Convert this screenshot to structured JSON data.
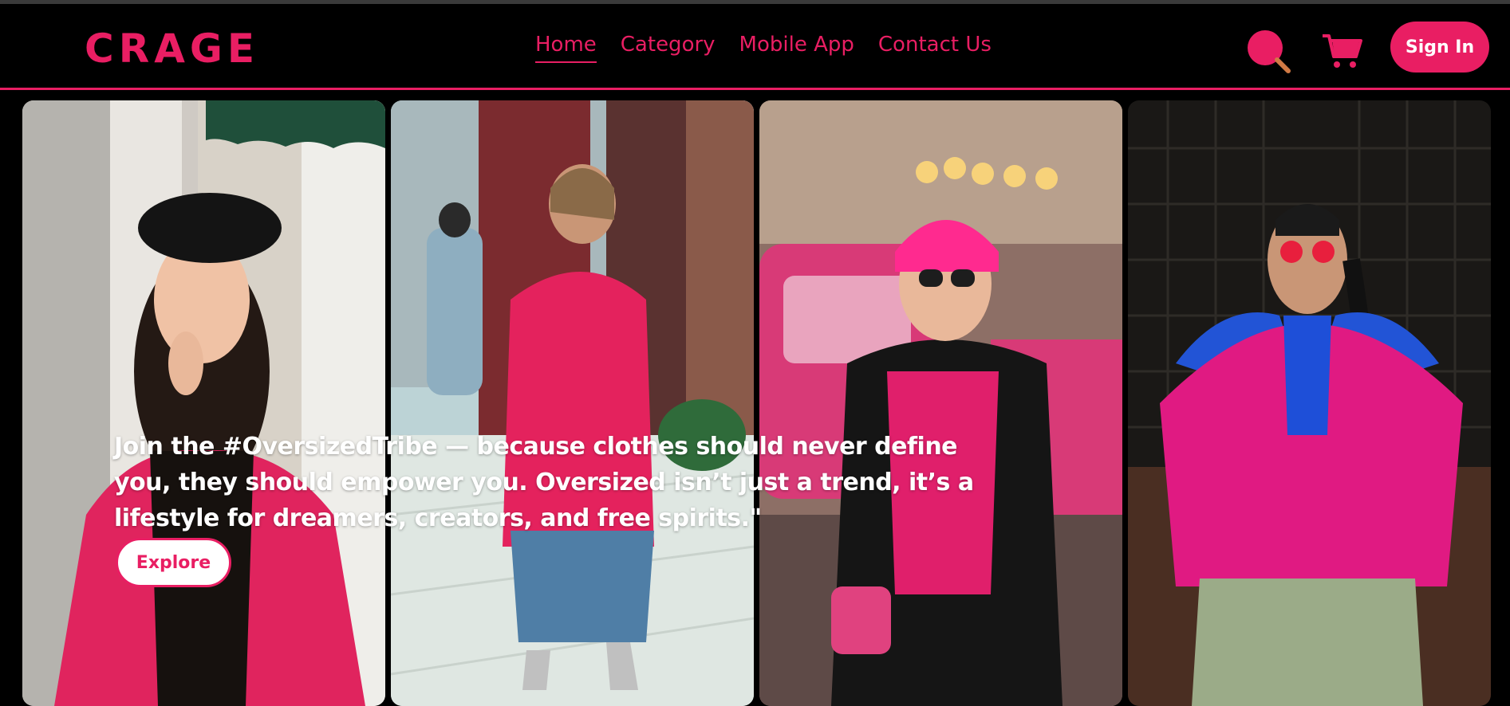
{
  "brand": {
    "logo_text": "CRAGE",
    "accent_color": "#e91e63",
    "background": "#000000"
  },
  "nav": {
    "items": [
      {
        "label": "Home",
        "active": true
      },
      {
        "label": "Category",
        "active": false
      },
      {
        "label": "Mobile App",
        "active": false
      },
      {
        "label": "Contact Us",
        "active": false
      }
    ]
  },
  "header_actions": {
    "search_icon": "search-icon",
    "cart_icon": "cart-icon",
    "signin_label": "Sign In"
  },
  "hero": {
    "text": "Join the #OversizedTribe — because clothes should never define you, they should empower you. Oversized isn’t just a trend, it’s a lifestyle for dreamers, creators, and free spirits.\"",
    "cta_label": "Explore"
  },
  "gallery": {
    "panels": [
      {
        "name": "model-black-beret-pink-coat"
      },
      {
        "name": "model-pink-coat-street"
      },
      {
        "name": "model-pink-beanie-black-vest"
      },
      {
        "name": "model-pink-jacket-red-sunglasses"
      }
    ]
  }
}
